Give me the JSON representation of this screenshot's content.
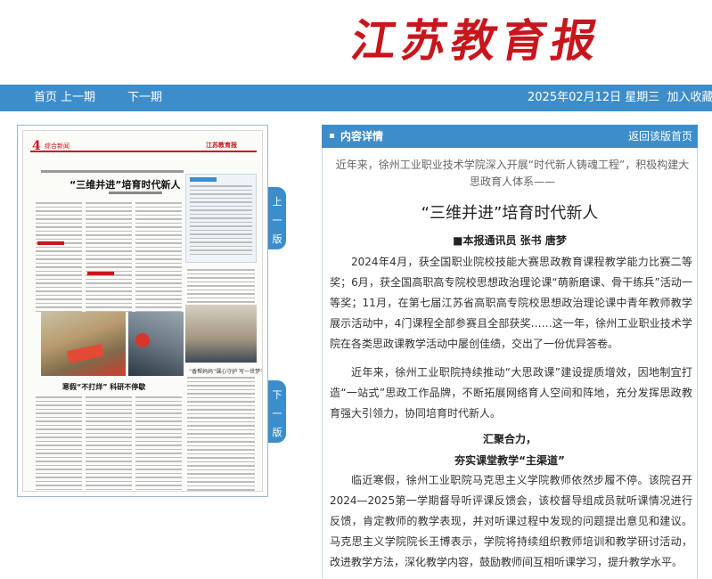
{
  "masthead": {
    "logo_text": "江苏教育报"
  },
  "nav": {
    "home": "首页",
    "prev_issue": "上一期",
    "next_issue": "下一期",
    "date": "2025年02月12日 星期三",
    "bookmark": "加入收藏"
  },
  "thumbnail": {
    "page_number": "4",
    "section": "综合新闻",
    "brand": "江苏教育报",
    "headline": "“三维并进”培育时代新人",
    "photo_caption": "寒假“不打烊” 科研不停歇",
    "side_caption": "“香帮妈妈”课心守护 写一世梦子"
  },
  "tabs": {
    "prev_page": [
      "上",
      "一",
      "版"
    ],
    "next_page": [
      "下",
      "一",
      "版"
    ]
  },
  "panel": {
    "title": "内容详情",
    "back_label": "返回该版首页"
  },
  "article": {
    "intro": "近年来，徐州工业职业技术学院深入开展“时代新人铸魂工程”，积极构建大思政育人体系——",
    "title": "“三维并进”培育时代新人",
    "byline": "■本报通讯员 张书 唐梦",
    "p1": "2024年4月，获全国职业院校技能大赛思政教育课程教学能力比赛二等奖；6月，获全国高职高专院校思想政治理论课“萌新磨课、骨干练兵”活动一等奖；11月，在第七届江苏省高职高专院校思想政治理论课中青年教师教学展示活动中，4门课程全部参赛且全部获奖……这一年，徐州工业职业技术学院在各类思政课教学活动中屡创佳绩，交出了一份优异答卷。",
    "p2": "近年来，徐州工业职院持续推动“大思政课”建设提质增效，因地制宜打造“一站式”思政工作品牌，不断拓展网络育人空间和阵地，充分发挥思政教育强大引领力，协同培育时代新人。",
    "section_title_1": "汇聚合力，",
    "section_title_2": "夯实课堂教学“主渠道”",
    "p3": "临近寒假，徐州工业职院马克思主义学院教师依然步履不停。该院召开2024—2025第一学期督导听评课反馈会，该校督导组成员就听课情况进行反馈，肯定教师的教学表现，并对听课过程中发现的问题提出意见和建议。马克思主义学院院长王博表示，学院将持续组织教师培训和教学研讨活动，改进教学方法，深化教学内容，鼓励教师间互相听课学习，提升教学水平。"
  },
  "colors": {
    "nav_blue": "#3e8dcb",
    "logo_red": "#c8161d"
  }
}
